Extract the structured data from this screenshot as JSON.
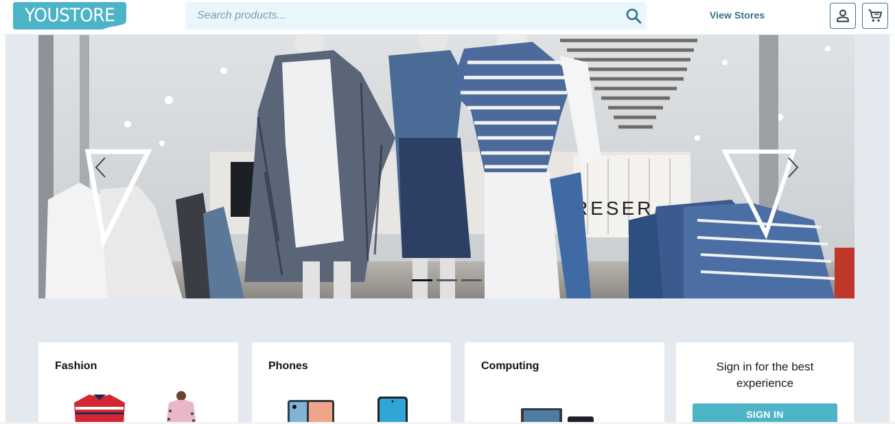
{
  "header": {
    "logo_text": "YOUSTORE",
    "search_placeholder": "Search products...",
    "view_stores_label": "View Stores",
    "account_icon": "account-icon",
    "cart_icon": "cart-icon",
    "search_icon": "search-icon"
  },
  "hero": {
    "slides_count": 3,
    "active_slide": 0,
    "banner_sign_text": "RESER"
  },
  "categories": [
    {
      "title": "Fashion"
    },
    {
      "title": "Phones"
    },
    {
      "title": "Computing"
    }
  ],
  "signin_card": {
    "text": "Sign in for the best experience",
    "button_label": "SIGN IN"
  },
  "colors": {
    "brand": "#4db3c7",
    "brand_dark": "#2e6f8b",
    "page_bg": "#e4e8ef",
    "search_bg": "#e9f6fc"
  }
}
